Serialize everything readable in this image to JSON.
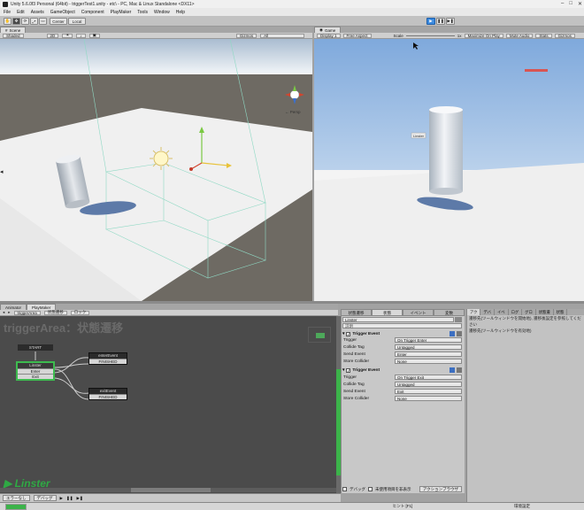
{
  "window": {
    "title": "Unity 5.6.0f3 Personal (64bit) - triggerTest1.unity - etc\\ - PC, Mac & Linux Standalone <DX11>"
  },
  "menu": [
    "File",
    "Edit",
    "Assets",
    "GameObject",
    "Component",
    "PlayMaker",
    "Tools",
    "Window",
    "Help"
  ],
  "toolbar": {
    "center_label": "Center",
    "local_label": "Local"
  },
  "scene_panel": {
    "tab": "Scene",
    "shaded": "Shaded",
    "mode_2d": "2D",
    "gizmos": "Gizmos",
    "search": "All",
    "persp": "← Persp"
  },
  "game_panel": {
    "tab": "Game",
    "display": "Display 1",
    "aspect": "Free Aspect",
    "scale_label": "Scale",
    "scale_value": "1x",
    "maximize": "Maximize On Play",
    "mute": "Mute Audio",
    "stats": "Stats",
    "gizmos": "Gizmos",
    "object_label": "Linster"
  },
  "bottom_tabs": [
    "Animator",
    "PlayMaker"
  ],
  "playmaker": {
    "fsm_owner": "triggerArea",
    "fsm_state_menu": "状態遷移",
    "lock": "ロック",
    "title": "triggerArea：状態遷移",
    "start_label": "START",
    "states": [
      {
        "name": "Linster",
        "events": [
          "Enter",
          "Exit"
        ]
      },
      {
        "name": "enterEvent",
        "events": [
          "FINISHED"
        ]
      },
      {
        "name": "exitEvent",
        "events": [
          "FINISHED"
        ]
      }
    ],
    "logo": "Linster",
    "bottom_debug": "デバッグ",
    "bottom_select": "エラーなし"
  },
  "inspector": {
    "tabs": [
      "状態遷移",
      "状態",
      "イベント",
      "変数"
    ],
    "state_name": "Linster",
    "description": "説明",
    "actions": [
      {
        "name": "Trigger Event",
        "fields": [
          {
            "label": "Trigger",
            "value": "On Trigger Enter"
          },
          {
            "label": "Collide Tag",
            "value": "Untagged"
          },
          {
            "label": "Send Event",
            "value": "Enter"
          },
          {
            "label": "Store Collider",
            "value": "None"
          }
        ]
      },
      {
        "name": "Trigger Event",
        "fields": [
          {
            "label": "Trigger",
            "value": "On Trigger Exit"
          },
          {
            "label": "Collide Tag",
            "value": "Untagged"
          },
          {
            "label": "Send Event",
            "value": "Exit"
          },
          {
            "label": "Store Collider",
            "value": "None"
          }
        ]
      }
    ],
    "debug_label": "デバッグ",
    "hide_label": "未使用項目を非表示",
    "action_browser": "アクションブラウザ",
    "hint_label": "ヒント [F1]"
  },
  "right_panel": {
    "tabs": [
      "アク",
      "デバ",
      "イベ",
      "ログ",
      "グロ",
      "状態遷",
      "状態"
    ],
    "lines": [
      "遷移先(ツールウィンドウを開始地), 遷移後設定を参照してください",
      "遷移先(ツールウィンドウを有効地)"
    ],
    "preference": "環境設定"
  },
  "colors": {
    "playmaker_green": "#2fa944",
    "unity_play_blue": "#3c8be0"
  }
}
